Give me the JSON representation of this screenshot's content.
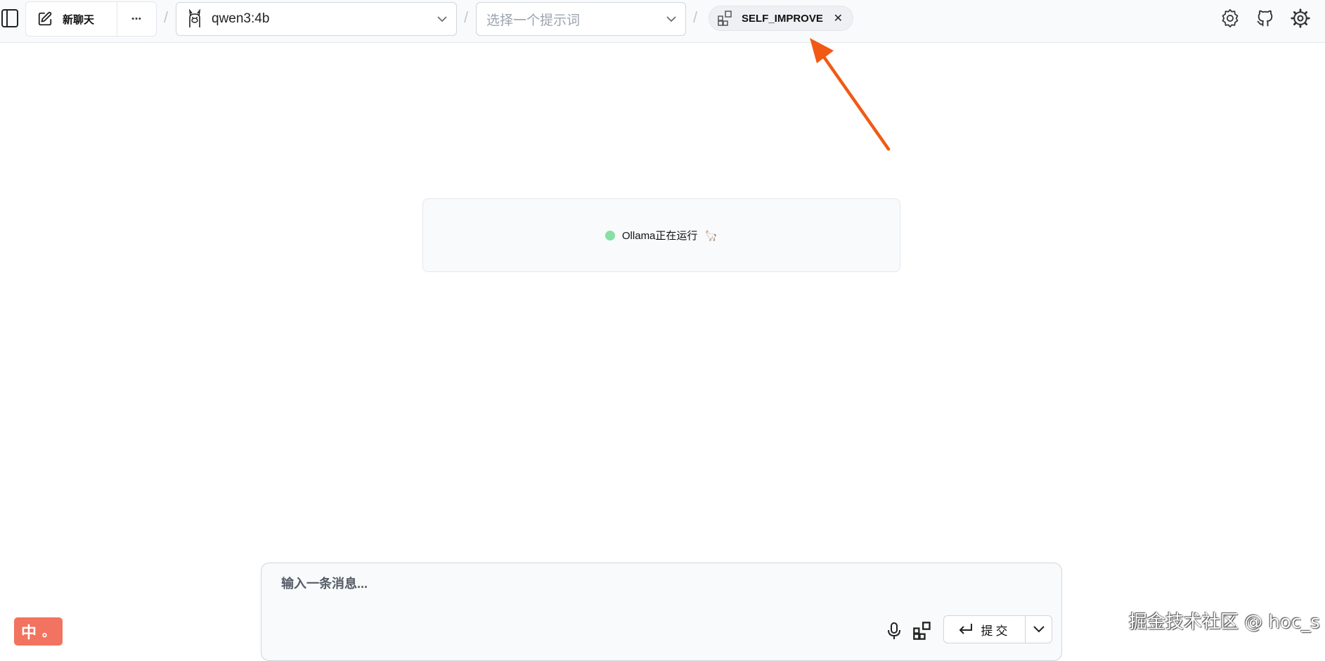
{
  "header": {
    "new_chat_label": "新聊天",
    "model": "qwen3:4b",
    "prompt_placeholder": "选择一个提示词",
    "separator": "/",
    "tool_chip": "SELF_IMPROVE",
    "close_symbol": "✕",
    "more_symbol": "•••"
  },
  "status": {
    "text": "Ollama正在运行",
    "emoji": "🦙",
    "dot_color": "#86e0a3"
  },
  "composer": {
    "placeholder": "输入一条消息...",
    "submit_label": "提交"
  },
  "ime": {
    "label": "中",
    "mark": "。"
  },
  "watermark": "掘金技术社区 @ hoc_s",
  "annotation_color": "#f05a14",
  "icons": [
    "sidebar-toggle-icon",
    "edit-icon",
    "more-icon",
    "llama-icon",
    "chevron-down-icon",
    "blocks-icon",
    "close-icon",
    "settings-gear-icon",
    "github-icon",
    "gear-icon",
    "mic-icon",
    "enter-icon",
    "chevron-down-icon",
    "arrow-annotation"
  ]
}
